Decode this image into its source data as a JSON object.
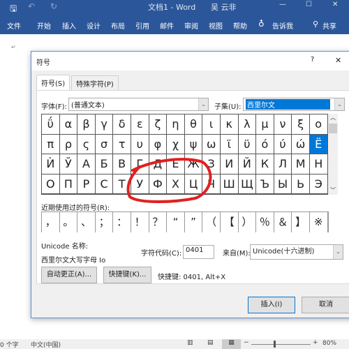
{
  "window": {
    "title": "文档1 - Word",
    "user": "吴 云非"
  },
  "ribbon": {
    "tabs": [
      "文件",
      "开始",
      "插入",
      "设计",
      "布局",
      "引用",
      "邮件",
      "审阅",
      "视图",
      "帮助"
    ],
    "tell_me": "告诉我",
    "share": "共享"
  },
  "dialog": {
    "title": "符号",
    "help": "?",
    "close": "✕",
    "tabs": [
      "符号(S)",
      "特殊字符(P)"
    ],
    "font_label": "字体(F):",
    "font_value": "(普通文本)",
    "subset_label": "子集(U):",
    "subset_value": "西里尔文",
    "symbols": [
      "ΰ",
      "α",
      "β",
      "γ",
      "δ",
      "ε",
      "ζ",
      "η",
      "θ",
      "ι",
      "κ",
      "λ",
      "μ",
      "ν",
      "ξ",
      "ο",
      "π",
      "ρ",
      "ς",
      "σ",
      "τ",
      "υ",
      "φ",
      "χ",
      "ψ",
      "ω",
      "ϊ",
      "ϋ",
      "ό",
      "ύ",
      "ώ",
      "Ё",
      "Ѝ",
      "Ў",
      "А",
      "Б",
      "В",
      "Г",
      "Д",
      "Е",
      "Ж",
      "З",
      "И",
      "Й",
      "К",
      "Л",
      "М",
      "Н",
      "О",
      "П",
      "Р",
      "С",
      "Т",
      "У",
      "Ф",
      "Х",
      "Ц",
      "Ч",
      "Ш",
      "Щ",
      "Ъ",
      "Ы",
      "Ь",
      "Э"
    ],
    "selected_symbol": "Ё",
    "recent_label": "近期使用过的符号(R):",
    "recent": [
      "，",
      "。",
      "、",
      "；",
      "：",
      "！",
      "？",
      "“",
      "”",
      "（",
      "【",
      "）",
      "％",
      "＆",
      "】",
      "※"
    ],
    "unicode_name_label": "Unicode 名称:",
    "unicode_name_value": "西里尔文大写字母 Io",
    "char_code_label": "字符代码(C):",
    "char_code_value": "0401",
    "from_label": "来自(M):",
    "from_value": "Unicode(十六进制)",
    "autocorrect_button": "自动更正(A)...",
    "shortcut_button": "快捷键(K)...",
    "shortcut_text": "快捷键: 0401, Alt+X",
    "insert_button": "插入(I)",
    "cancel_button": "取消"
  },
  "status": {
    "words": "0 个字",
    "language": "中文(中国)",
    "zoom": "80%"
  },
  "colors": {
    "brand": "#2b579a",
    "selection": "#0078d7",
    "annotation": "#e02020"
  }
}
